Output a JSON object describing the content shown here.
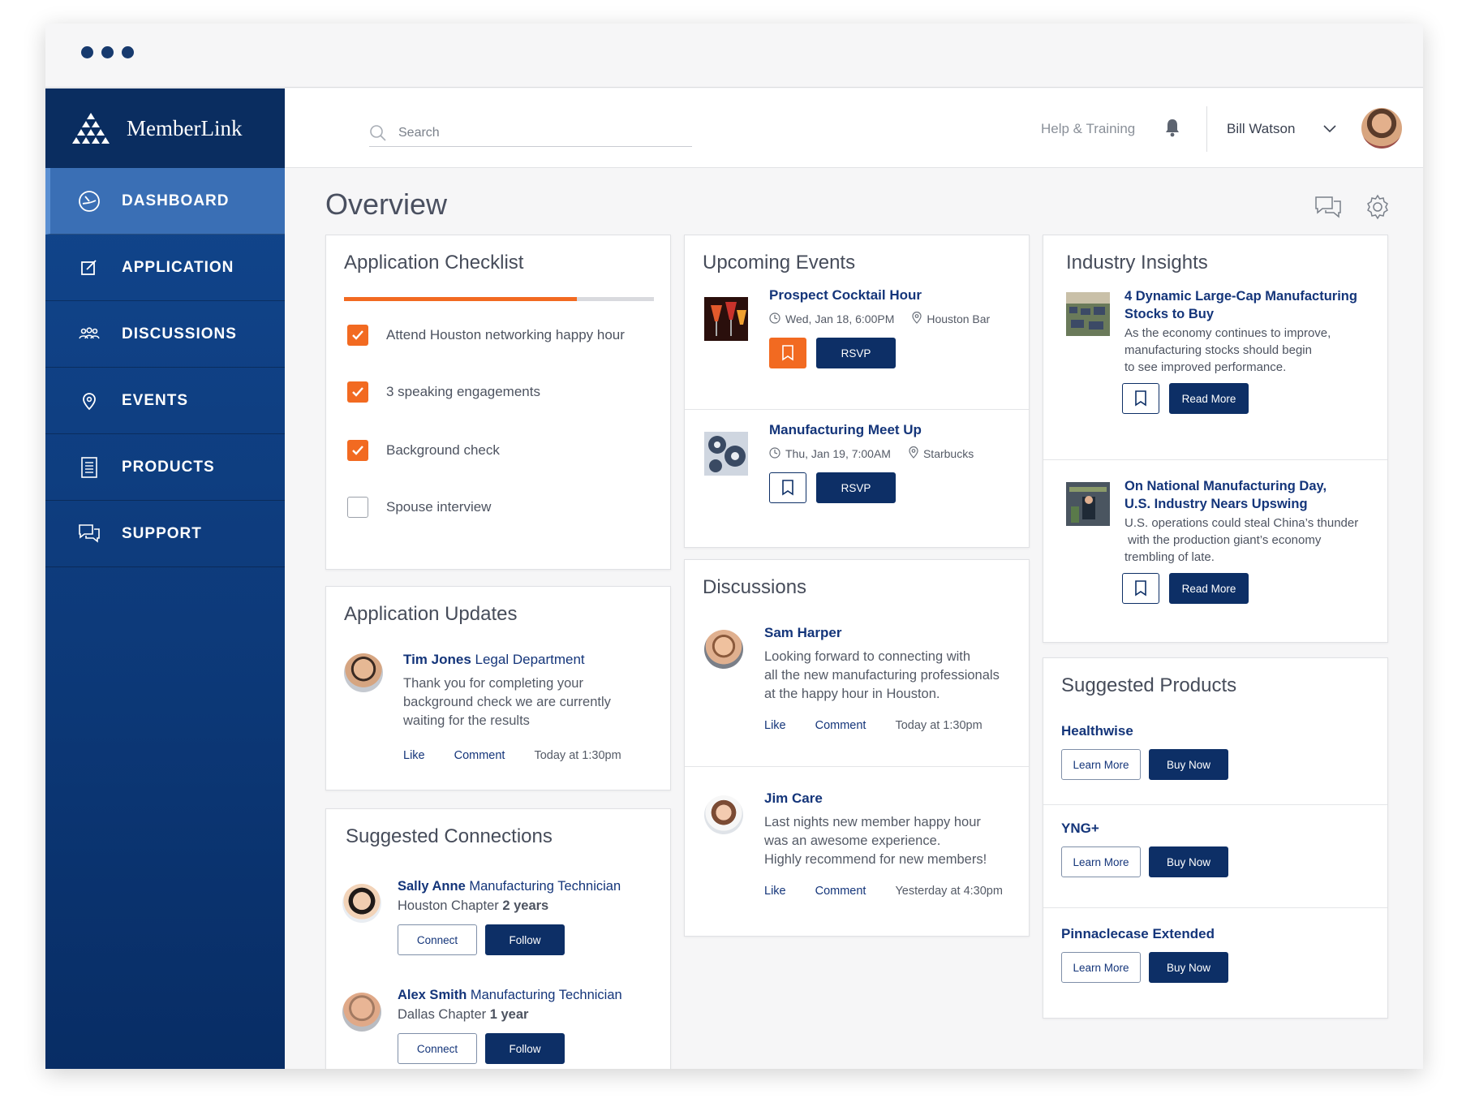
{
  "app": {
    "name": "MemberLink"
  },
  "nav": [
    {
      "label": "DASHBOARD",
      "icon": "dashboard-icon",
      "active": true
    },
    {
      "label": "APPLICATION",
      "icon": "edit-icon",
      "active": false
    },
    {
      "label": "DISCUSSIONS",
      "icon": "people-icon",
      "active": false
    },
    {
      "label": "EVENTS",
      "icon": "location-pin-icon",
      "active": false
    },
    {
      "label": "PRODUCTS",
      "icon": "document-icon",
      "active": false
    },
    {
      "label": "SUPPORT",
      "icon": "chat-icon",
      "active": false
    }
  ],
  "topbar": {
    "search_placeholder": "Search",
    "help": "Help & Training",
    "user_name": "Bill Watson"
  },
  "page_title": "Overview",
  "checklist": {
    "title": "Application Checklist",
    "progress": 0.75,
    "items": [
      {
        "label": "Attend Houston networking happy hour",
        "checked": true
      },
      {
        "label": "3 speaking engagements",
        "checked": true
      },
      {
        "label": "Background check",
        "checked": true
      },
      {
        "label": "Spouse interview",
        "checked": false
      }
    ]
  },
  "updates": {
    "title": "Application Updates",
    "items": [
      {
        "name": "Tim Jones",
        "role": "Legal Department",
        "lines": [
          "Thank you for completing your",
          "background check we are currently",
          "waiting for the results"
        ],
        "like": "Like",
        "comment": "Comment",
        "time": "Today at 1:30pm"
      }
    ]
  },
  "connections": {
    "title": "Suggested Connections",
    "items": [
      {
        "name": "Sally Anne",
        "role": "Manufacturing Technician",
        "chapter": "Houston Chapter",
        "tenure": "2 years",
        "connect": "Connect",
        "follow": "Follow"
      },
      {
        "name": "Alex Smith",
        "role": "Manufacturing Technician",
        "chapter": "Dallas Chapter",
        "tenure": "1 year",
        "connect": "Connect",
        "follow": "Follow"
      }
    ]
  },
  "events": {
    "title": "Upcoming Events",
    "items": [
      {
        "title": "Prospect Cocktail Hour",
        "date": "Wed, Jan 18, 6:00PM",
        "location": "Houston Bar",
        "rsvp": "RSVP",
        "bookmarked": true
      },
      {
        "title": "Manufacturing Meet Up",
        "date": "Thu, Jan 19, 7:00AM",
        "location": "Starbucks",
        "rsvp": "RSVP",
        "bookmarked": false
      }
    ]
  },
  "discussions": {
    "title": "Discussions",
    "items": [
      {
        "name": "Sam Harper",
        "lines": [
          "Looking forward to connecting with",
          "all the new manufacturing professionals",
          "at the happy hour in Houston."
        ],
        "like": "Like",
        "comment": "Comment",
        "time": "Today at 1:30pm"
      },
      {
        "name": "Jim Care",
        "lines": [
          "Last nights new member happy hour",
          "was an awesome experience.",
          "Highly recommend for new members!"
        ],
        "like": "Like",
        "comment": "Comment",
        "time": "Yesterday at 4:30pm"
      }
    ]
  },
  "insights": {
    "title": "Industry Insights",
    "items": [
      {
        "title_lines": [
          "4 Dynamic Large-Cap Manufacturing",
          "Stocks to Buy"
        ],
        "body_lines": [
          "As the economy continues to improve,",
          "manufacturing stocks should begin",
          "to see improved performance."
        ],
        "read_more": "Read More"
      },
      {
        "title_lines": [
          "On National Manufacturing Day,",
          "U.S. Industry Nears Upswing"
        ],
        "body_lines": [
          "U.S. operations could steal China’s thunder",
          " with the production giant’s economy",
          "trembling of late."
        ],
        "read_more": "Read More"
      }
    ]
  },
  "products": {
    "title": "Suggested Products",
    "items": [
      {
        "name": "Healthwise",
        "learn": "Learn More",
        "buy": "Buy Now"
      },
      {
        "name": "YNG+",
        "learn": "Learn More",
        "buy": "Buy Now"
      },
      {
        "name": "Pinnaclecase Extended",
        "learn": "Learn More",
        "buy": "Buy Now"
      }
    ]
  },
  "colors": {
    "primary": "#0d2f66",
    "accent": "#f26a21",
    "sidebar": "#12478f",
    "active_nav": "#3a6fb5"
  }
}
